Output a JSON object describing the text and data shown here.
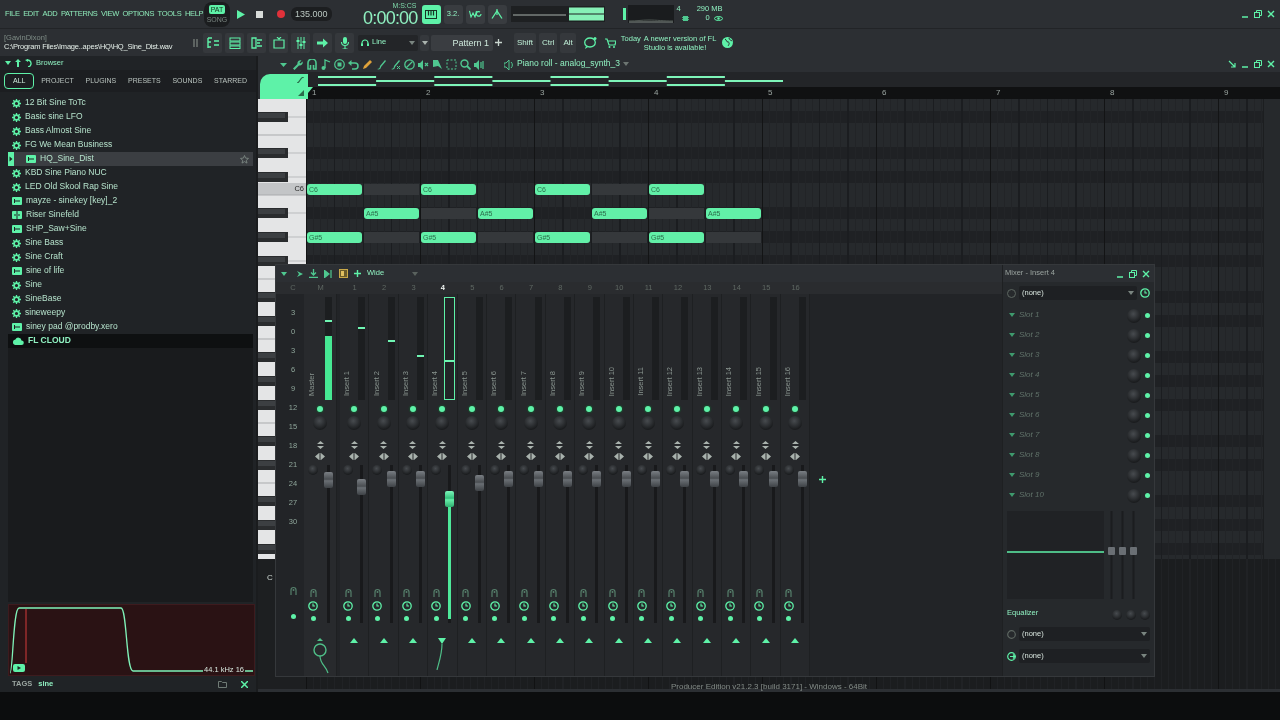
{
  "menu": [
    "FILE",
    "EDIT",
    "ADD",
    "PATTERNS",
    "VIEW",
    "OPTIONS",
    "TOOLS",
    "HELP"
  ],
  "transport": {
    "modes": [
      {
        "label": "PAT",
        "selected": true
      },
      {
        "label": "SONG",
        "selected": false
      }
    ],
    "tempo": "135.000",
    "time_unit": "M:S:CS",
    "time": "0:00:00"
  },
  "toggles": [
    {
      "kind": "keyboard",
      "on": true
    },
    {
      "kind": "countdown",
      "label": "3.2.",
      "on": false
    },
    {
      "kind": "loop",
      "on": false
    },
    {
      "kind": "metronome",
      "on": false
    }
  ],
  "monitor": {
    "voices": "4",
    "memory": "290 MB",
    "count": "0"
  },
  "hint": {
    "user": "[GavinDixon]",
    "path": "C:\\Program Files\\Image..apes\\HQ\\HQ_Sine_Dist.wav"
  },
  "input": {
    "label": "Line"
  },
  "pattern": {
    "name": "Pattern 1"
  },
  "modifiers": [
    {
      "label": "Shift"
    },
    {
      "label": "Ctrl"
    },
    {
      "label": "Alt"
    }
  ],
  "news": {
    "date": "Today",
    "text": "A newer version of FL Studio is available!"
  },
  "browser": {
    "title": "Browser",
    "tabs": [
      {
        "label": "ALL",
        "selected": true
      },
      {
        "label": "PROJECT",
        "selected": false
      },
      {
        "label": "PLUGINS",
        "selected": false
      },
      {
        "label": "PRESETS",
        "selected": false
      },
      {
        "label": "SOUNDS",
        "selected": false
      },
      {
        "label": "STARRED",
        "selected": false
      }
    ],
    "items": [
      {
        "label": "12 Bit Sine ToTc",
        "kind": "preset",
        "selected": false
      },
      {
        "label": "Basic sine LFO",
        "kind": "preset",
        "selected": false
      },
      {
        "label": "Bass Almost Sine",
        "kind": "preset",
        "selected": false
      },
      {
        "label": "FG We Mean Business",
        "kind": "preset",
        "selected": false
      },
      {
        "label": "HQ_Sine_Dist",
        "kind": "audio",
        "selected": true
      },
      {
        "label": "KBD Sine Piano NUC",
        "kind": "preset",
        "selected": false
      },
      {
        "label": "LED Old Skool Rap Sine",
        "kind": "preset",
        "selected": false
      },
      {
        "label": "mayze - sinekey [key]_2",
        "kind": "audio",
        "selected": false
      },
      {
        "label": "Riser Sinefeld",
        "kind": "sliced",
        "selected": false
      },
      {
        "label": "SHP_Saw+Sine",
        "kind": "audio",
        "selected": false
      },
      {
        "label": "Sine Bass",
        "kind": "preset",
        "selected": false
      },
      {
        "label": "Sine Craft",
        "kind": "preset",
        "selected": false
      },
      {
        "label": "sine of life",
        "kind": "audio",
        "selected": false
      },
      {
        "label": "Sine",
        "kind": "preset",
        "selected": false
      },
      {
        "label": "SineBase",
        "kind": "preset",
        "selected": false
      },
      {
        "label": "sineweepy",
        "kind": "preset",
        "selected": false
      },
      {
        "label": "siney pad @prodby.xero",
        "kind": "audio",
        "selected": false
      }
    ],
    "cloud": {
      "label": "FL CLOUD"
    },
    "preview": {
      "info": "44.1 kHz 16"
    },
    "tags": {
      "label": "TAGS",
      "value": "sine"
    }
  },
  "piano_roll": {
    "title": "Piano roll - analog_synth_3",
    "bars": [
      "1",
      "2",
      "3",
      "4",
      "5",
      "6",
      "7",
      "8",
      "9"
    ],
    "labeled_key": "C6",
    "lane_label": "C",
    "rows": [
      {
        "steps": [
          {
            "kind": "note",
            "label": "C6"
          },
          {
            "kind": "ghost"
          },
          {
            "kind": "note",
            "label": "C6"
          },
          {
            "kind": "rest"
          },
          {
            "kind": "note",
            "label": "C6"
          },
          {
            "kind": "ghost"
          },
          {
            "kind": "note",
            "label": "C6"
          },
          {
            "kind": "rest"
          }
        ]
      },
      {
        "steps": [
          {
            "kind": "rest"
          },
          {
            "kind": "note",
            "label": "A#5"
          },
          {
            "kind": "ghost"
          },
          {
            "kind": "note",
            "label": "A#5"
          },
          {
            "kind": "rest"
          },
          {
            "kind": "note",
            "label": "A#5"
          },
          {
            "kind": "ghost"
          },
          {
            "kind": "note",
            "label": "A#5"
          }
        ]
      },
      {
        "steps": [
          {
            "kind": "note",
            "label": "G#5"
          },
          {
            "kind": "ghost"
          },
          {
            "kind": "note",
            "label": "G#5"
          },
          {
            "kind": "ghost"
          },
          {
            "kind": "note",
            "label": "G#5"
          },
          {
            "kind": "ghost"
          },
          {
            "kind": "note",
            "label": "G#5"
          },
          {
            "kind": "ghost"
          }
        ]
      }
    ]
  },
  "mixer": {
    "preset": "Wide",
    "scale_header": "C",
    "scale": [
      "3",
      "0",
      "3",
      "6",
      "9",
      "12",
      "15",
      "18",
      "21",
      "24",
      "27",
      "30"
    ],
    "tracks": [
      {
        "kind": "master",
        "number": "M",
        "name": "Master",
        "selected": false,
        "meter": {
          "level": 0.62
        },
        "hold": {
          "level": 0.76
        },
        "fader": {
          "level": 0.95
        }
      },
      {
        "kind": "insert",
        "number": "1",
        "name": "Insert 1",
        "selected": false,
        "hold": {
          "level": 0.69
        },
        "fader": {
          "level": 0.9
        }
      },
      {
        "kind": "insert",
        "number": "2",
        "name": "Insert 2",
        "selected": false,
        "hold": {
          "level": 0.56
        },
        "fader": {
          "level": 0.96
        }
      },
      {
        "kind": "insert",
        "number": "3",
        "name": "Insert 3",
        "selected": false,
        "hold": {
          "level": 0.42
        },
        "fader": {
          "level": 0.96
        }
      },
      {
        "kind": "insert",
        "number": "4",
        "name": "Insert 4",
        "selected": true,
        "hold": {
          "level": 0.37
        },
        "fader": {
          "level": 0.82
        }
      },
      {
        "kind": "insert",
        "number": "5",
        "name": "Insert 5",
        "selected": false,
        "fader": {
          "level": 0.93
        }
      },
      {
        "kind": "insert",
        "number": "6",
        "name": "Insert 6",
        "selected": false,
        "fader": {
          "level": 0.96
        }
      },
      {
        "kind": "insert",
        "number": "7",
        "name": "Insert 7",
        "selected": false,
        "fader": {
          "level": 0.96
        }
      },
      {
        "kind": "insert",
        "number": "8",
        "name": "Insert 8",
        "selected": false,
        "fader": {
          "level": 0.96
        }
      },
      {
        "kind": "insert",
        "number": "9",
        "name": "Insert 9",
        "selected": false,
        "fader": {
          "level": 0.96
        }
      },
      {
        "kind": "insert",
        "number": "10",
        "name": "Insert 10",
        "selected": false,
        "fader": {
          "level": 0.96
        }
      },
      {
        "kind": "insert",
        "number": "11",
        "name": "Insert 11",
        "selected": false,
        "fader": {
          "level": 0.96
        }
      },
      {
        "kind": "insert",
        "number": "12",
        "name": "Insert 12",
        "selected": false,
        "fader": {
          "level": 0.96
        }
      },
      {
        "kind": "insert",
        "number": "13",
        "name": "Insert 13",
        "selected": false,
        "fader": {
          "level": 0.96
        }
      },
      {
        "kind": "insert",
        "number": "14",
        "name": "Insert 14",
        "selected": false,
        "fader": {
          "level": 0.96
        }
      },
      {
        "kind": "insert",
        "number": "15",
        "name": "Insert 15",
        "selected": false,
        "fader": {
          "level": 0.96
        }
      },
      {
        "kind": "insert",
        "number": "16",
        "name": "Insert 16",
        "selected": false,
        "fader": {
          "level": 0.96
        }
      }
    ],
    "panel": {
      "title": "Mixer - Insert 4",
      "input": "(none)",
      "slots": [
        {
          "label": "Slot 1",
          "on": true
        },
        {
          "label": "Slot 2",
          "on": true
        },
        {
          "label": "Slot 3",
          "on": true
        },
        {
          "label": "Slot 4",
          "on": true
        },
        {
          "label": "Slot 5",
          "on": true
        },
        {
          "label": "Slot 6",
          "on": true
        },
        {
          "label": "Slot 7",
          "on": true
        },
        {
          "label": "Slot 8",
          "on": true
        },
        {
          "label": "Slot 9",
          "on": true
        },
        {
          "label": "Slot 10",
          "on": true
        }
      ],
      "eq_label": "Equalizer",
      "outputs": [
        {
          "label": "(none)",
          "on": false
        },
        {
          "label": "(none)",
          "on": true
        }
      ]
    }
  },
  "version": "Producer Edition v21.2.3 [build 3171] - Windows - 64Bit"
}
